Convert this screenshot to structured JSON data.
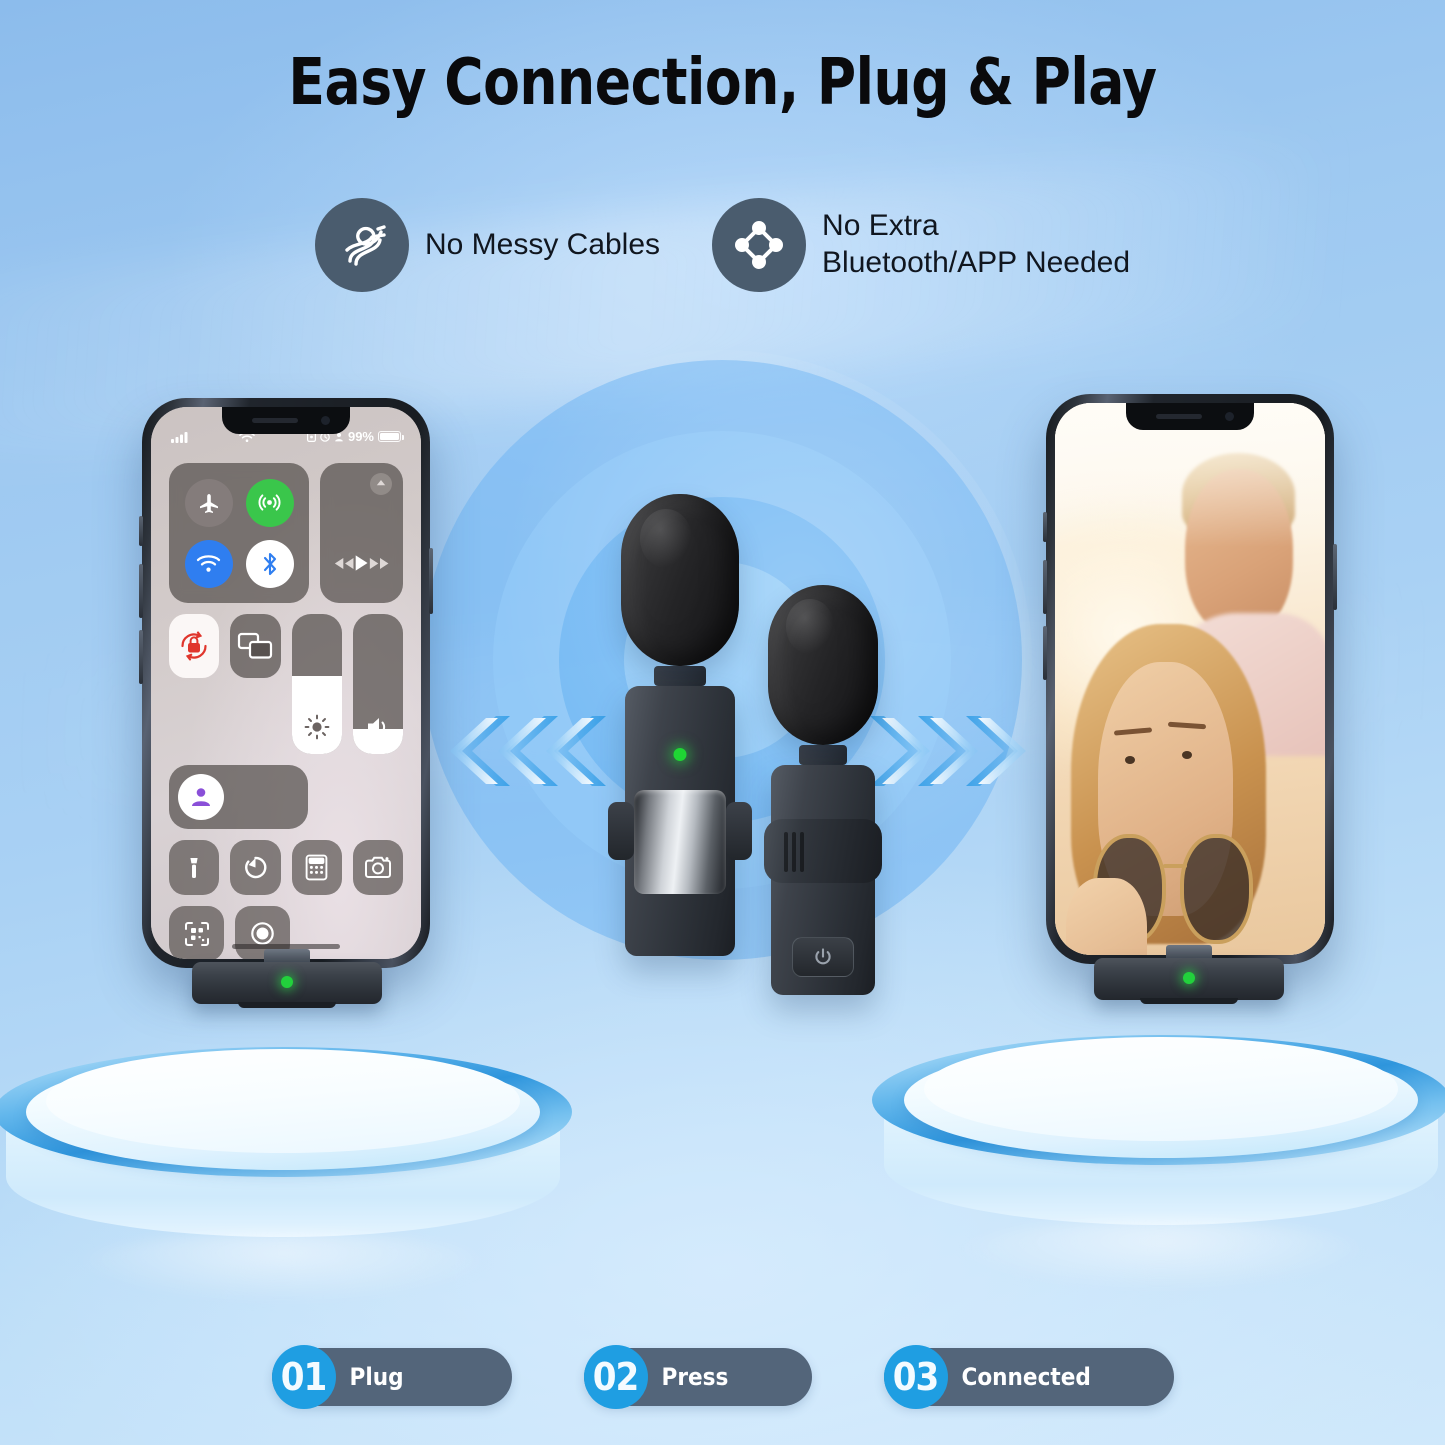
{
  "page": {
    "title": "Easy Connection, Plug & Play",
    "background_color": "#82b7ea",
    "accent_color": "#1f9ee2",
    "badge_color": "#53657a",
    "led_color": "#22d13c"
  },
  "features": [
    {
      "icon": "tangled-cable-icon",
      "label": "No Messy Cables"
    },
    {
      "icon": "network-nodes-icon",
      "label": "No Extra\nBluetooth/APP Needed"
    }
  ],
  "phone_left": {
    "name": "control-center-phone",
    "status_bar": {
      "signal": "signal-bars-icon",
      "wifi": "wifi-icon",
      "orientation_lock": "orientation-lock-icon",
      "do_not_disturb": "do-not-disturb-icon",
      "person": "person-icon",
      "battery_percent": "99%",
      "battery": "battery-icon"
    },
    "control_center": {
      "airplane_mode": "airplane-icon",
      "cellular": "cellular-icon",
      "wifi": "wifi-icon",
      "bluetooth": "bluetooth-icon",
      "airplay": "airplay-icon",
      "media_prev": "rewind-icon",
      "media_play": "play-icon",
      "media_next": "fast-forward-icon",
      "rotation_lock": "rotation-lock-icon",
      "screen_mirroring": "screen-mirroring-icon",
      "brightness": "brightness-icon",
      "volume": "volume-icon",
      "focus": "focus-icon",
      "shortcuts": [
        "flashlight-icon",
        "timer-icon",
        "calculator-icon",
        "camera-icon",
        "qr-scanner-icon",
        "screen-record-icon"
      ]
    }
  },
  "phone_right": {
    "name": "selfie-photo-phone",
    "photo_description": "couple-selfie-sunset"
  },
  "receivers": [
    {
      "name": "receiver-dongle-left",
      "led": "green"
    },
    {
      "name": "receiver-dongle-right",
      "led": "green"
    }
  ],
  "microphones": [
    {
      "name": "lavalier-mic-front",
      "led": "green",
      "has_chrome_clip": true
    },
    {
      "name": "lavalier-mic-back",
      "power_button": "power-icon",
      "has_grip": true
    }
  ],
  "arrows": {
    "left": "chevrons-left-icon",
    "right": "chevrons-right-icon"
  },
  "steps": [
    {
      "number": "01",
      "label": "Plug"
    },
    {
      "number": "02",
      "label": "Press"
    },
    {
      "number": "03",
      "label": "Connected"
    }
  ]
}
